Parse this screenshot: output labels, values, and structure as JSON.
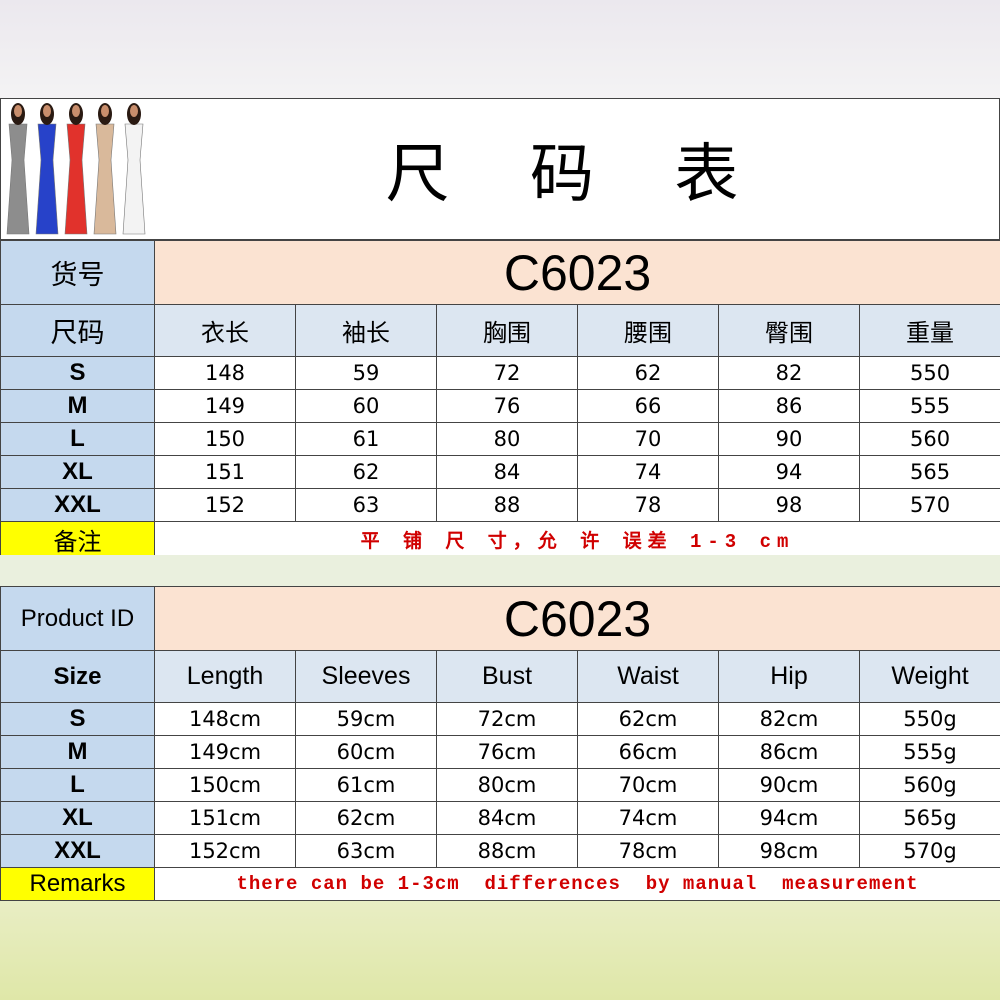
{
  "cn": {
    "title": "尺 码 表",
    "id_label": "货号",
    "product_id": "C6023",
    "size_label": "尺码",
    "headers": [
      "衣长",
      "袖长",
      "胸围",
      "腰围",
      "臀围",
      "重量"
    ],
    "rows": [
      {
        "size": "S",
        "values": [
          "148",
          "59",
          "72",
          "62",
          "82",
          "550"
        ]
      },
      {
        "size": "M",
        "values": [
          "149",
          "60",
          "76",
          "66",
          "86",
          "555"
        ]
      },
      {
        "size": "L",
        "values": [
          "150",
          "61",
          "80",
          "70",
          "90",
          "560"
        ]
      },
      {
        "size": "XL",
        "values": [
          "151",
          "62",
          "84",
          "74",
          "94",
          "565"
        ]
      },
      {
        "size": "XXL",
        "values": [
          "152",
          "63",
          "88",
          "78",
          "98",
          "570"
        ]
      }
    ],
    "remarks_label": "备注",
    "remarks_text": "平 铺 尺 寸，允 许 误差 1-3 cm"
  },
  "en": {
    "id_label": "Product ID",
    "product_id": "C6023",
    "size_label": "Size",
    "headers": [
      "Length",
      "Sleeves",
      "Bust",
      "Waist",
      "Hip",
      "Weight"
    ],
    "rows": [
      {
        "size": "S",
        "values": [
          "148cm",
          "59cm",
          "72cm",
          "62cm",
          "82cm",
          "550g"
        ]
      },
      {
        "size": "M",
        "values": [
          "149cm",
          "60cm",
          "76cm",
          "66cm",
          "86cm",
          "555g"
        ]
      },
      {
        "size": "L",
        "values": [
          "150cm",
          "61cm",
          "80cm",
          "70cm",
          "90cm",
          "560g"
        ]
      },
      {
        "size": "XL",
        "values": [
          "151cm",
          "62cm",
          "84cm",
          "74cm",
          "94cm",
          "565g"
        ]
      },
      {
        "size": "XXL",
        "values": [
          "152cm",
          "63cm",
          "88cm",
          "78cm",
          "98cm",
          "570g"
        ]
      }
    ],
    "remarks_label": "Remarks",
    "remarks_text": "there can be 1-3cm  differences  by manual  measurement"
  },
  "model_colors": [
    "#8d8d8d",
    "#2742c9",
    "#e1322c",
    "#d9b99b",
    "#f3f3f3"
  ]
}
